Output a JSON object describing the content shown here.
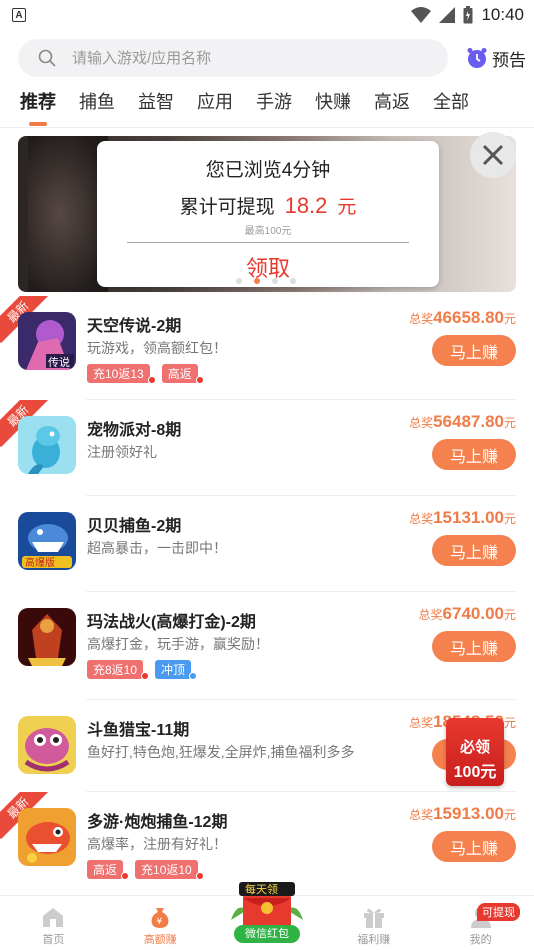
{
  "status_bar": {
    "time": "10:40"
  },
  "search": {
    "placeholder": "请输入游戏/应用名称"
  },
  "preview": {
    "label": "预告"
  },
  "tabs": [
    {
      "label": "推荐",
      "active": true
    },
    {
      "label": "捕鱼"
    },
    {
      "label": "益智"
    },
    {
      "label": "应用"
    },
    {
      "label": "手游"
    },
    {
      "label": "快赚"
    },
    {
      "label": "高返"
    },
    {
      "label": "全部"
    }
  ],
  "popup": {
    "title": "您已浏览4分钟",
    "withdraw_label": "累计可提现",
    "amount": "18.2",
    "unit": "元",
    "max_note": "最高100元",
    "claim_label": "领取"
  },
  "banner": {
    "slides": 4,
    "active_slide": 2
  },
  "apps": [
    {
      "name": "天空传说-2期",
      "desc": "玩游戏，领高额红包！",
      "tags": [
        "充10返13",
        "高返"
      ],
      "tag_colors": [
        "red",
        "red"
      ],
      "newest": true,
      "reward_prefix": "总奖",
      "reward": "46658.80",
      "unit": "元",
      "button": "马上赚",
      "icon": "sky-legend-icon"
    },
    {
      "name": "宠物派对-8期",
      "desc": "注册领好礼",
      "tags": [],
      "newest": true,
      "reward_prefix": "总奖",
      "reward": "56487.80",
      "unit": "元",
      "button": "马上赚",
      "icon": "pet-party-icon"
    },
    {
      "name": "贝贝捕鱼-2期",
      "desc": "超高暴击，一击即中！",
      "tags": [],
      "newest": false,
      "reward_prefix": "总奖",
      "reward": "15131.00",
      "unit": "元",
      "button": "马上赚",
      "icon": "beibei-fishing-icon"
    },
    {
      "name": "玛法战火(高爆打金)-2期",
      "desc": "高爆打金，玩手游，赢奖励！",
      "tags": [
        "充8返10",
        "冲顶"
      ],
      "tag_colors": [
        "red",
        "blue"
      ],
      "newest": false,
      "reward_prefix": "总奖",
      "reward": "6740.00",
      "unit": "元",
      "button": "马上赚",
      "icon": "mafa-war-icon"
    },
    {
      "name": "斗鱼猎宝-11期",
      "desc": "鱼好打,特色炮,狂爆发,全屏炸,捕鱼福利多多",
      "tags": [],
      "newest": false,
      "reward_prefix": "总奖",
      "reward": "18548.50",
      "unit": "元",
      "button": "马上赚",
      "icon": "douyu-hunt-icon"
    },
    {
      "name": "多游·炮炮捕鱼-12期",
      "desc": "高爆率，注册有好礼！",
      "tags": [
        "高返",
        "充10返10"
      ],
      "tag_colors": [
        "red",
        "red"
      ],
      "newest": true,
      "reward_prefix": "总奖",
      "reward": "15913.00",
      "unit": "元",
      "button": "马上赚",
      "icon": "paopao-fishing-icon"
    }
  ],
  "ribbon_label": "最新",
  "float_packet": {
    "line1": "必领",
    "line2": "100元"
  },
  "bottom_nav": {
    "items": [
      {
        "label": "首页",
        "icon": "home-icon"
      },
      {
        "label": "高额赚",
        "icon": "money-bag-icon",
        "active": true
      },
      {
        "label": "",
        "icon": "red-packet-icon"
      },
      {
        "label": "福利赚",
        "icon": "gift-icon"
      },
      {
        "label": "我的",
        "icon": "user-icon"
      }
    ],
    "center_top": "每天领",
    "center_label": "微信红包",
    "badge": "可提现"
  },
  "colors": {
    "accent": "#f07c48",
    "red": "#e8392e",
    "green": "#2fb344"
  }
}
